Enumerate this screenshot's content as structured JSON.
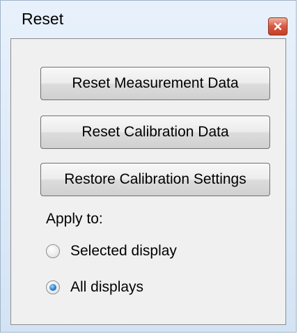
{
  "window": {
    "title": "Reset"
  },
  "buttons": {
    "reset_measurement": "Reset Measurement Data",
    "reset_calibration": "Reset Calibration Data",
    "restore_calibration": "Restore Calibration Settings"
  },
  "apply": {
    "label": "Apply to:",
    "options": [
      {
        "label": "Selected display",
        "checked": false
      },
      {
        "label": "All displays",
        "checked": true
      }
    ]
  },
  "icons": {
    "close": "close-icon"
  },
  "colors": {
    "close_button": "#d8583f",
    "radio_selected": "#2a7fd0"
  }
}
